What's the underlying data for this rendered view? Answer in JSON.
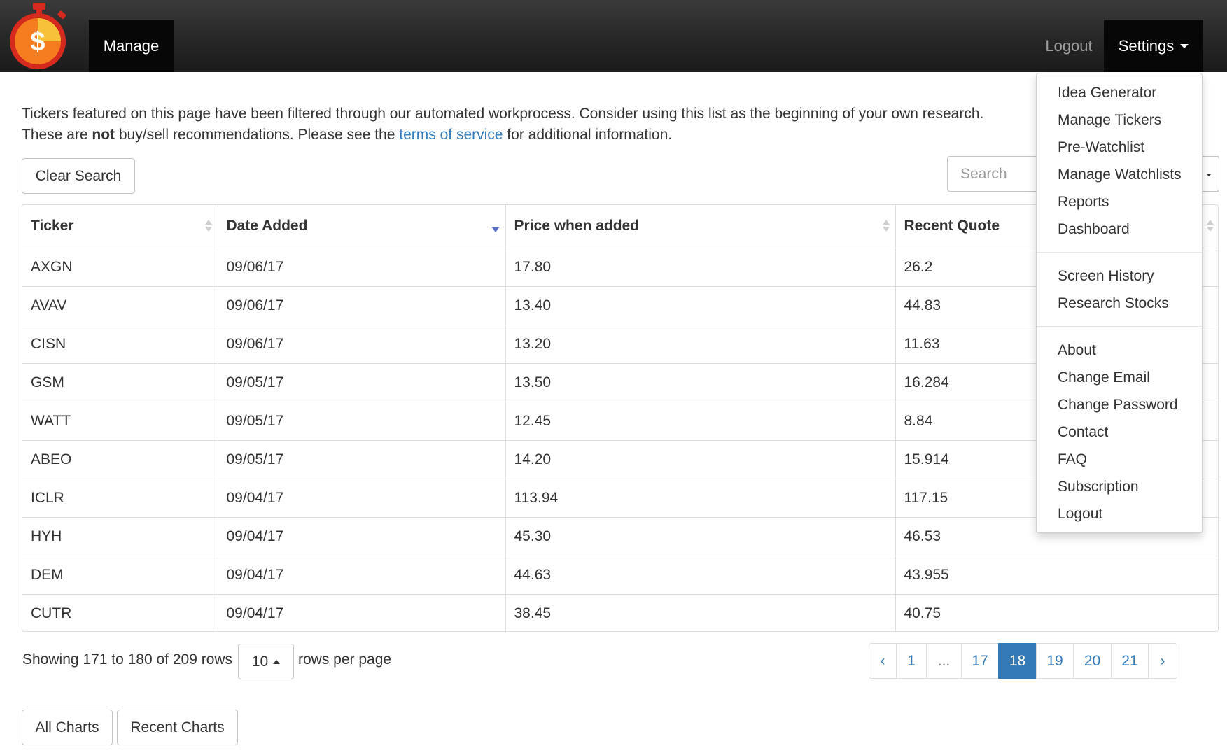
{
  "navbar": {
    "logo_symbol": "$",
    "manage_label": "Manage",
    "logout_label": "Logout",
    "settings_label": "Settings"
  },
  "settings_menu": {
    "group1": [
      "Idea Generator",
      "Manage Tickers",
      "Pre-Watchlist",
      "Manage Watchlists",
      "Reports",
      "Dashboard"
    ],
    "group2": [
      "Screen History",
      "Research Stocks"
    ],
    "group3": [
      "About",
      "Change Email",
      "Change Password",
      "Contact",
      "FAQ",
      "Subscription",
      "Logout"
    ]
  },
  "intro": {
    "line1": "Tickers featured on this page have been filtered through our automated workprocess. Consider using this list as the beginning of your own research.",
    "line2_before": "These are ",
    "line2_bold": "not",
    "line2_middle": " buy/sell recommendations. Please see the ",
    "line2_link": "terms of service",
    "line2_after": " for additional information."
  },
  "toolbar": {
    "clear_search_label": "Clear Search",
    "search_placeholder": "Search"
  },
  "table": {
    "columns": [
      "Ticker",
      "Date Added",
      "Price when added",
      "Recent Quote"
    ],
    "rows": [
      [
        "AXGN",
        "09/06/17",
        "17.80",
        "26.2"
      ],
      [
        "AVAV",
        "09/06/17",
        "13.40",
        "44.83"
      ],
      [
        "CISN",
        "09/06/17",
        "13.20",
        "11.63"
      ],
      [
        "GSM",
        "09/05/17",
        "13.50",
        "16.284"
      ],
      [
        "WATT",
        "09/05/17",
        "12.45",
        "8.84"
      ],
      [
        "ABEO",
        "09/05/17",
        "14.20",
        "15.914"
      ],
      [
        "ICLR",
        "09/04/17",
        "113.94",
        "117.15"
      ],
      [
        "HYH",
        "09/04/17",
        "45.30",
        "46.53"
      ],
      [
        "DEM",
        "09/04/17",
        "44.63",
        "43.955"
      ],
      [
        "CUTR",
        "09/04/17",
        "38.45",
        "40.75"
      ]
    ]
  },
  "footer": {
    "showing_text": "Showing 171 to 180 of 209 rows",
    "page_size": "10",
    "rows_per_page_text": "rows per page"
  },
  "pagination": {
    "prev": "‹",
    "pages": [
      "1",
      "...",
      "17",
      "18",
      "19",
      "20",
      "21"
    ],
    "next": "›",
    "active": "18"
  },
  "bottom_buttons": {
    "all_charts": "All Charts",
    "recent_charts": "Recent Charts"
  },
  "colors": {
    "navbar_dark": "#1b1b1b",
    "accent_blue": "#337ab7",
    "logo_orange": "#f57c1f",
    "logo_red": "#d62a1e",
    "logo_yellow": "#f7c23a"
  }
}
